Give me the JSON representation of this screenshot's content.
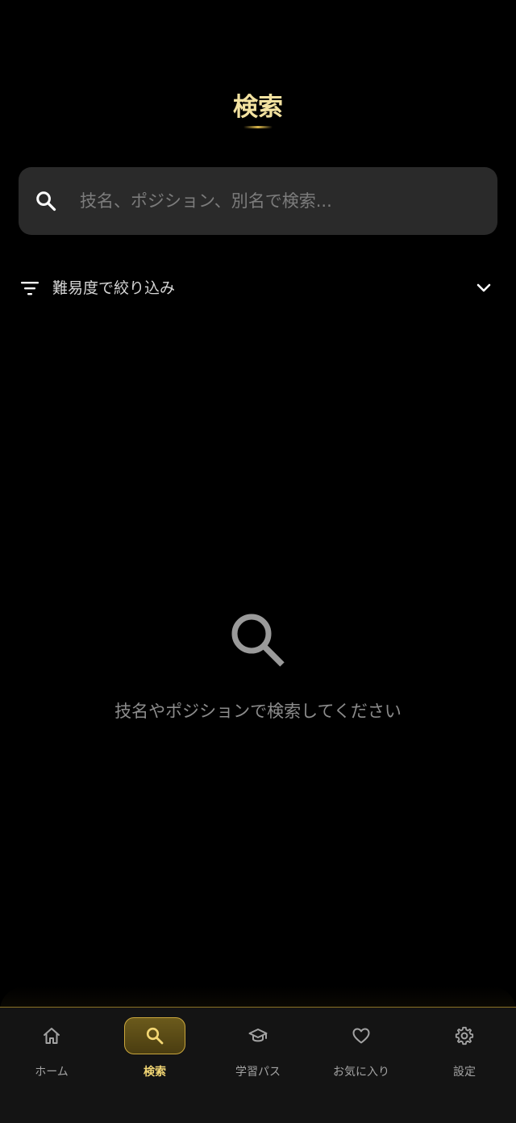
{
  "header": {
    "title": "検索"
  },
  "search": {
    "placeholder": "技名、ポジション、別名で検索...",
    "value": ""
  },
  "filter": {
    "label": "難易度で絞り込み"
  },
  "empty_state": {
    "message": "技名やポジションで検索してください"
  },
  "bottom_nav": {
    "items": [
      {
        "label": "ホーム",
        "icon": "home-icon",
        "active": false
      },
      {
        "label": "検索",
        "icon": "search-icon",
        "active": true
      },
      {
        "label": "学習パス",
        "icon": "graduation-cap-icon",
        "active": false
      },
      {
        "label": "お気に入り",
        "icon": "heart-icon",
        "active": false
      },
      {
        "label": "設定",
        "icon": "gear-icon",
        "active": false
      }
    ]
  },
  "colors": {
    "background": "#000000",
    "accent_gold": "#f3d774",
    "title_gold": "#f3e2a0",
    "search_background": "#2a2a2a",
    "nav_background": "#141414"
  }
}
